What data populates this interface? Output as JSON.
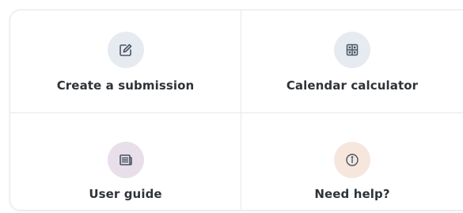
{
  "tiles": [
    {
      "label": "Create a submission",
      "icon": "edit-icon",
      "icon_bg": "#e6ebf1",
      "icon_color": "#4a5461"
    },
    {
      "label": "Calendar calculator",
      "icon": "calendar-grid-icon",
      "icon_bg": "#e6ebf1",
      "icon_color": "#4a5461"
    },
    {
      "label": "User guide",
      "icon": "guide-icon",
      "icon_bg": "#e8dfeb",
      "icon_color": "#4a5461"
    },
    {
      "label": "Need help?",
      "icon": "info-icon",
      "icon_bg": "#f6e7de",
      "icon_color": "#4a5461"
    }
  ]
}
